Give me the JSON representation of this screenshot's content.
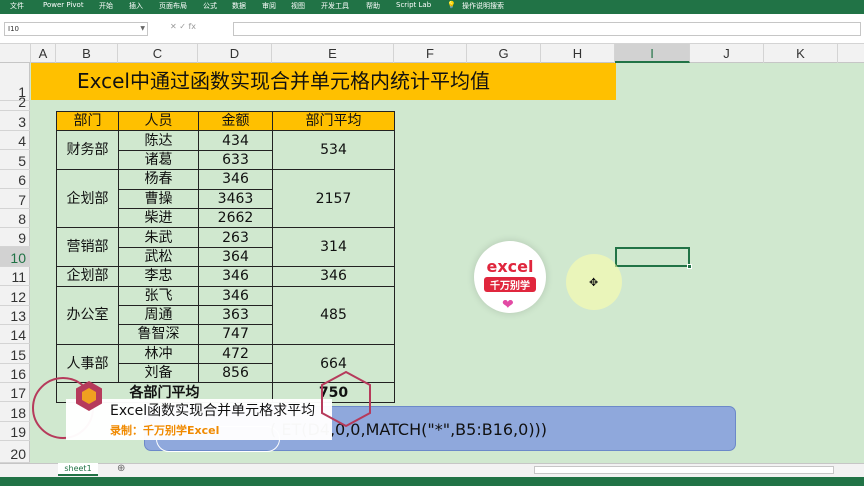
{
  "ribbon": {
    "tabs": [
      "文件",
      "Power Pivot",
      "开始",
      "插入",
      "页面布局",
      "公式",
      "数据",
      "审阅",
      "视图",
      "开发工具",
      "帮助",
      "Script Lab",
      "操作说明搜索"
    ]
  },
  "formula_bar": {
    "name_box": "I10",
    "fx_glyphs": "✕  ✓  fx",
    "formula": ""
  },
  "columns": [
    "A",
    "B",
    "C",
    "D",
    "E",
    "F",
    "G",
    "H",
    "I",
    "J",
    "K"
  ],
  "rows": [
    "1",
    "2",
    "3",
    "4",
    "5",
    "6",
    "7",
    "8",
    "9",
    "10",
    "11",
    "12",
    "13",
    "14",
    "15",
    "16",
    "17",
    "18",
    "19",
    "20"
  ],
  "selected": {
    "column": "I",
    "row": "10"
  },
  "title": "Excel中通过函数实现合并单元格内统计平均值",
  "table": {
    "headers": [
      "部门",
      "人员",
      "金额",
      "部门平均"
    ],
    "groups": [
      {
        "dept": "财务部",
        "avg": "534",
        "rows": [
          [
            "陈达",
            "434"
          ],
          [
            "诸葛",
            "633"
          ]
        ]
      },
      {
        "dept": "企划部",
        "avg": "2157",
        "rows": [
          [
            "杨春",
            "346"
          ],
          [
            "曹操",
            "3463"
          ],
          [
            "柴进",
            "2662"
          ]
        ]
      },
      {
        "dept": "营销部",
        "avg": "314",
        "rows": [
          [
            "朱武",
            "263"
          ],
          [
            "武松",
            "364"
          ]
        ]
      },
      {
        "dept": "企划部",
        "avg": "346",
        "rows": [
          [
            "李忠",
            "346"
          ]
        ]
      },
      {
        "dept": "办公室",
        "avg": "485",
        "rows": [
          [
            "张飞",
            "346"
          ],
          [
            "周通",
            "363"
          ],
          [
            "鲁智深",
            "747"
          ]
        ]
      },
      {
        "dept": "人事部",
        "avg": "664",
        "rows": [
          [
            "林冲",
            "472"
          ],
          [
            "刘备",
            "856"
          ]
        ]
      }
    ],
    "total_label": "各部门平均",
    "total_value": "750"
  },
  "logo": {
    "word": "excel",
    "sub": "千万别学",
    "heart": "❤"
  },
  "formula_banner": "(        ET(D4,0,0,MATCH(\"*\",B5:B16,0)))",
  "caption": {
    "title": "Excel函数实现合并单元格求平均",
    "subtitle": "录制：千万别学Excel"
  },
  "sheet_tab": "sheet1",
  "add_sheet": "⊕",
  "cursor_glyph": "✥"
}
